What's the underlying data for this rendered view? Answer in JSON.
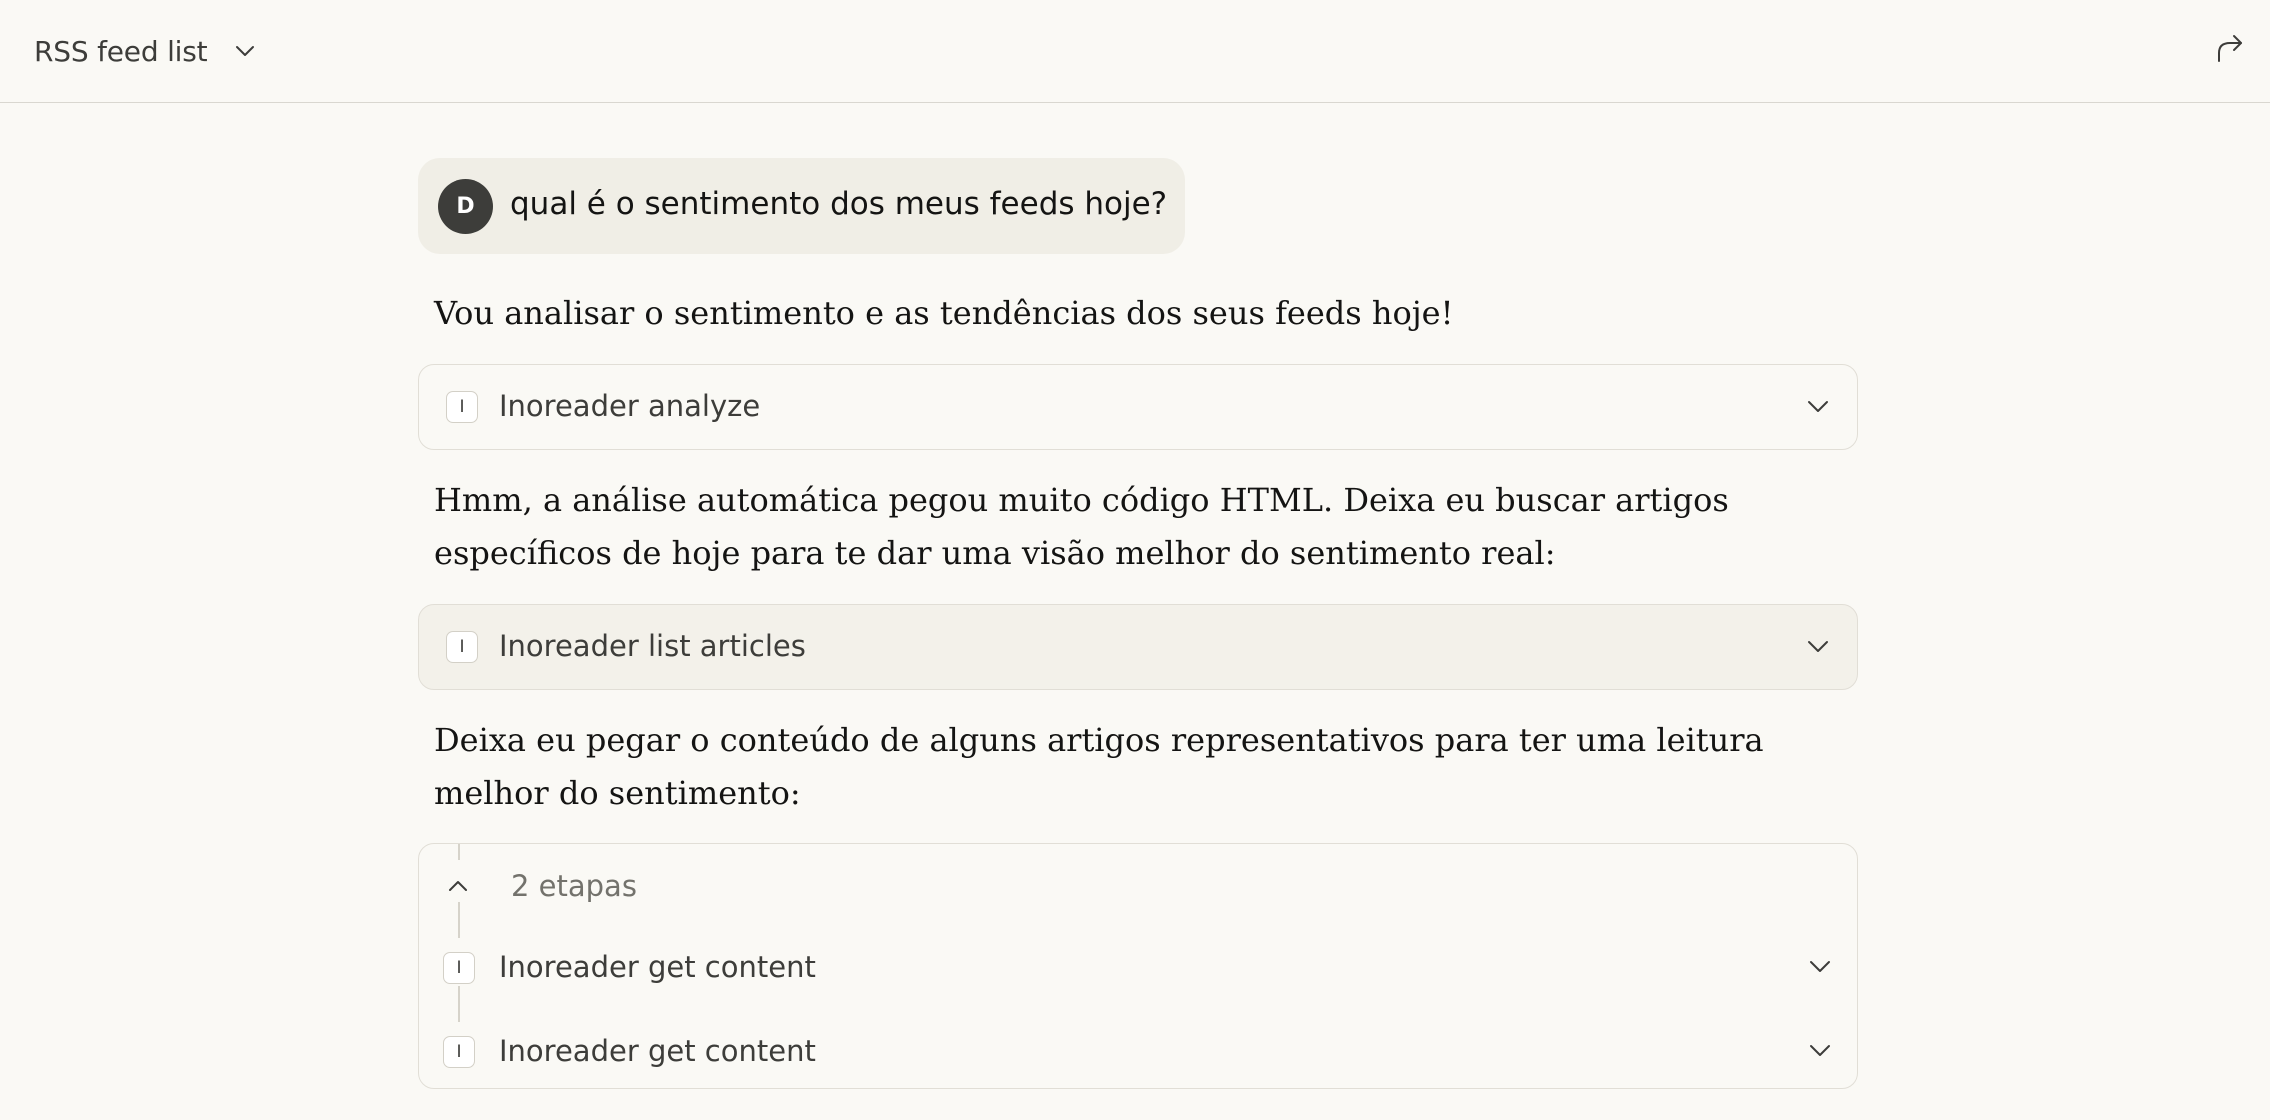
{
  "header": {
    "title": "RSS feed list",
    "title_chevron_icon": "chevron-down-icon",
    "share_icon": "share-arrow-icon"
  },
  "user_message": {
    "avatar_initial": "D",
    "text": "qual é o sentimento dos meus feeds hoje?"
  },
  "assistant": {
    "intro": "Vou analisar o sentimento e as tendências dos seus feeds hoje!",
    "tool_1": {
      "icon_letter": "I",
      "label": "Inoreader analyze"
    },
    "follow_up": "Hmm, a análise automática pegou muito código HTML. Deixa eu buscar artigos específicos de hoje para te dar uma visão melhor do sentimento real:",
    "tool_2": {
      "icon_letter": "I",
      "label": "Inoreader list articles"
    },
    "content_note": "Deixa eu pegar o conteúdo de alguns artigos representativos para ter uma leitura melhor do sentimento:",
    "steps": {
      "label": "2 etapas",
      "items": [
        {
          "icon_letter": "I",
          "label": "Inoreader get content"
        },
        {
          "icon_letter": "I",
          "label": "Inoreader get content"
        }
      ]
    }
  },
  "colors": {
    "background": "#faf9f5",
    "user_bubble": "#f0eee6",
    "avatar": "#3d3d3a",
    "border": "#e1ded6"
  }
}
